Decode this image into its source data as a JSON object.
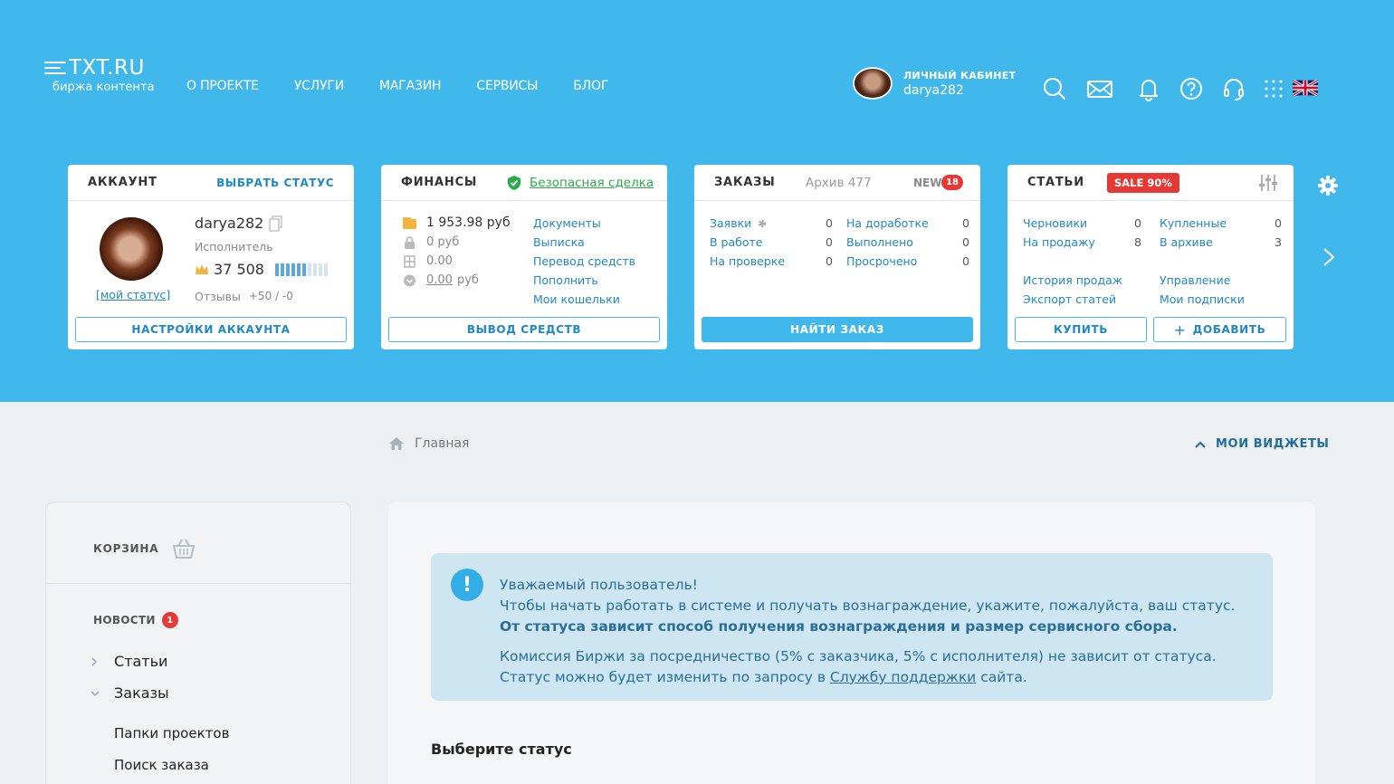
{
  "header": {
    "logo_main": "TXT.RU",
    "logo_sub": "биржа контента",
    "nav": [
      "О ПРОЕКТЕ",
      "УСЛУГИ",
      "МАГАЗИН",
      "СЕРВИСЫ",
      "БЛОГ"
    ],
    "profile_label": "ЛИЧНЫЙ КАБИНЕТ",
    "profile_name": "darya282",
    "icons": [
      "search-icon",
      "mail-icon",
      "bell-icon",
      "help-icon",
      "headset-icon",
      "apps-grid-icon",
      "uk-flag-icon"
    ]
  },
  "account": {
    "title": "АККАУНТ",
    "action": "ВЫБРАТЬ СТАТУС",
    "username": "darya282",
    "role": "Исполнитель",
    "rating": "37 508",
    "rating_level": 0.6,
    "my_status": "[мой статус]",
    "reviews_label": "Отзывы",
    "reviews_value": "+50 / -0",
    "button": "НАСТРОЙКИ АККАУНТА"
  },
  "finance": {
    "title": "ФИНАНСЫ",
    "safe_deal": "Безопасная сделка",
    "rows": [
      "1 953.98 руб",
      "0 руб",
      "0.00",
      "0.00"
    ],
    "row4_suffix": "руб",
    "links": [
      "Документы",
      "Выписка",
      "Перевод средств",
      "Пополнить",
      "Мои кошельки"
    ],
    "button": "ВЫВОД СРЕДСТВ"
  },
  "orders": {
    "title": "ЗАКАЗЫ",
    "archive": "Архив 477",
    "new_label": "NEW",
    "new_count": "18",
    "left": [
      {
        "label": "Заявки",
        "value": "0"
      },
      {
        "label": "В работе",
        "value": "0"
      },
      {
        "label": "На проверке",
        "value": "0"
      }
    ],
    "right": [
      {
        "label": "На доработке",
        "value": "0"
      },
      {
        "label": "Выполнено",
        "value": "0"
      },
      {
        "label": "Просрочено",
        "value": "0"
      }
    ],
    "button": "НАЙТИ ЗАКАЗ"
  },
  "articles": {
    "title": "СТАТЬИ",
    "sale": "SALE 90%",
    "left": [
      {
        "label": "Черновики",
        "value": "0"
      },
      {
        "label": "На продажу",
        "value": "8"
      }
    ],
    "right": [
      {
        "label": "Купленные",
        "value": "0"
      },
      {
        "label": "В архиве",
        "value": "3"
      }
    ],
    "links_left": [
      "История продаж",
      "Экспорт статей"
    ],
    "links_right": [
      "Управление",
      "Мои подписки"
    ],
    "buy": "КУПИТЬ",
    "add": "ДОБАВИТЬ"
  },
  "breadcrumb": {
    "home": "Главная"
  },
  "widgets_toggle": "МОИ ВИДЖЕТЫ",
  "sidebar": {
    "cart": "КОРЗИНА",
    "news": "НОВОСТИ",
    "news_badge": "1",
    "tree": [
      {
        "label": "Статьи",
        "expanded": false
      },
      {
        "label": "Заказы",
        "expanded": true
      }
    ],
    "sub": [
      "Папки проектов",
      "Поиск заказа"
    ]
  },
  "alert": {
    "line1": "Уважаемый пользователь!",
    "line2": "Чтобы начать работать в системе и получать вознаграждение, укажите, пожалуйста, ваш статус.",
    "line3": "От статуса зависит способ получения вознаграждения и размер сервисного сбора.",
    "line4": "Комиссия Биржи за посредничество (5% с заказчика, 5% с исполнителя) не зависит от статуса.",
    "line5_pre": "Статус можно будет изменить по запросу в ",
    "line5_link": "Службу поддержки",
    "line5_post": " сайта."
  },
  "choose_status": "Выберите статус",
  "colors": {
    "header_bg": "#41b8ec",
    "accent": "#1f88c5",
    "sale": "#e53935",
    "safe_green": "#2bab4a",
    "alert_bg": "#cde6f2"
  }
}
